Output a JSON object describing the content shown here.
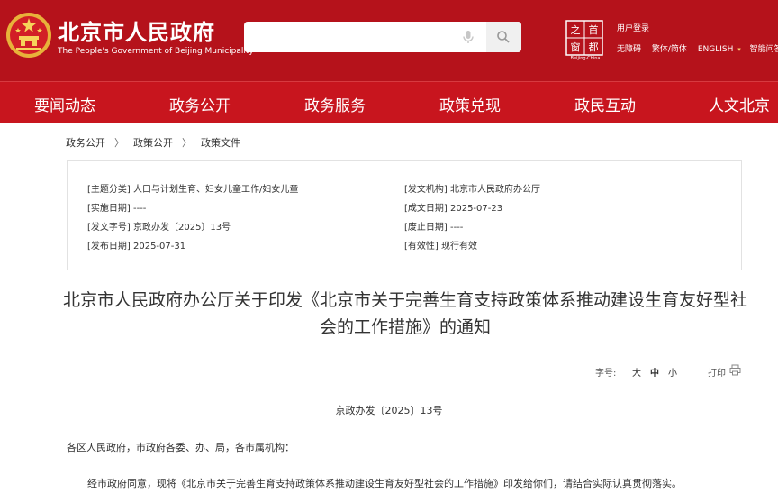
{
  "header": {
    "title": "北京市人民政府",
    "subtitle": "The People's Government of Beijing Municipality",
    "search": {
      "placeholder": ""
    },
    "logo_chars": [
      "之",
      "首",
      "窗",
      "都"
    ],
    "logo_caption": "Beijing·China",
    "utility": {
      "login": "用户登录",
      "accessible": "无障碍",
      "trad_simp": "繁体/简体",
      "english": "ENGLISH",
      "english_caret": "▾",
      "smart_qa": "智能问答"
    }
  },
  "nav": {
    "items": [
      "要闻动态",
      "政务公开",
      "政务服务",
      "政策兑现",
      "政民互动",
      "人文北京"
    ]
  },
  "breadcrumb": {
    "items": [
      "政务公开",
      "政策公开",
      "政策文件"
    ],
    "separator": "〉"
  },
  "meta": {
    "topic": "[主题分类]  人口与计划生育、妇女儿童工作/妇女儿童",
    "issuer": "[发文机构]  北京市人民政府办公厅",
    "effective_date": "[实施日期]  ----",
    "written_date": "[成文日期]  2025-07-23",
    "doc_number": "[发文字号]  京政办发〔2025〕13号",
    "repeal_date": "[废止日期]  ----",
    "publish_date": "[发布日期]  2025-07-31",
    "validity": "[有效性]  现行有效"
  },
  "document": {
    "title": "北京市人民政府办公厅关于印发《北京市关于完善生育支持政策体系推动建设生育友好型社会的工作措施》的通知",
    "font_label": "字号:",
    "font_large": "大",
    "font_medium": "中",
    "font_small": "小",
    "print_label": "打印",
    "doc_no": "京政办发〔2025〕13号",
    "recipients": "各区人民政府，市政府各委、办、局，各市属机构：",
    "body": "经市政府同意，现将《北京市关于完善生育支持政策体系推动建设生育友好型社会的工作措施》印发给你们，请结合实际认真贯彻落实。"
  },
  "colors": {
    "header_red": "#b5121b",
    "nav_red": "#c8151e",
    "emblem_gold": "#f3c96a"
  }
}
